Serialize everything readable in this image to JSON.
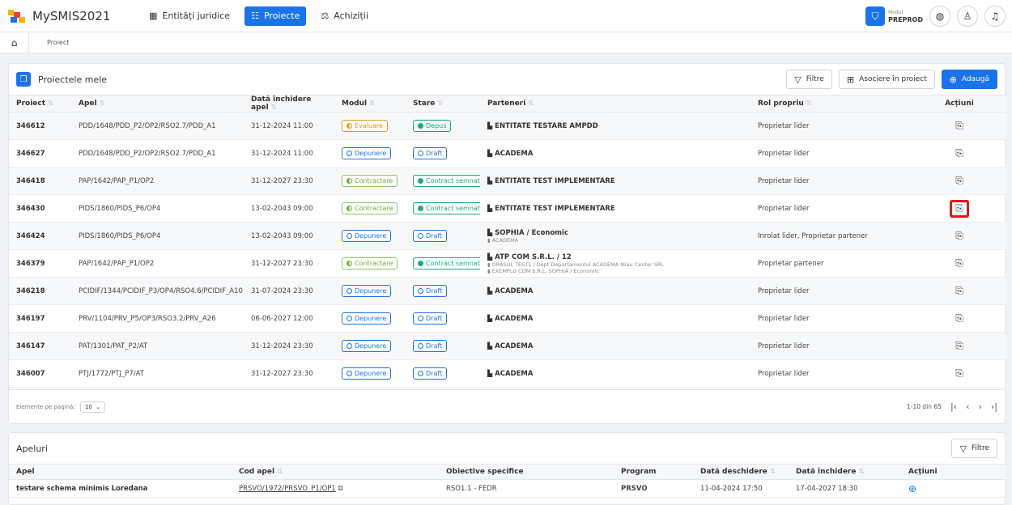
{
  "app": {
    "name": "MySMIS2021"
  },
  "nav": [
    {
      "label": "Entități juridice",
      "icon": "building-icon",
      "active": false
    },
    {
      "label": "Proiecte",
      "icon": "projects-icon",
      "active": true
    },
    {
      "label": "Achiziții",
      "icon": "scale-icon",
      "active": false
    }
  ],
  "mode": {
    "line1": "Modul",
    "line2": "PREPROD"
  },
  "breadcrumb": {
    "current": "Proiect"
  },
  "projects": {
    "title": "Proiectele mele",
    "filter_label": "Filtre",
    "associate_label": "Asociere în proiect",
    "add_label": "Adaugă",
    "columns": [
      "Proiect",
      "Apel",
      "Dată închidere apel",
      "Modul",
      "Stare",
      "Parteneri",
      "Rol propriu",
      "Acțiuni"
    ],
    "rows": [
      {
        "id": "346612",
        "apel": "PDD/1648/PDD_P2/OP2/RSO2.7/PDD_A1",
        "date": "31-12-2024 11:00",
        "modul": "Evaluare",
        "modul_type": "eval",
        "stare": "Depus",
        "stare_type": "depus",
        "partner": "ENTITATE TESTARE AMPDD",
        "sub": "",
        "rol": "Proprietar lider"
      },
      {
        "id": "346627",
        "apel": "PDD/1648/PDD_P2/OP2/RSO2.7/PDD_A1",
        "date": "31-12-2024 11:00",
        "modul": "Depunere",
        "modul_type": "dep",
        "stare": "Draft",
        "stare_type": "draft",
        "partner": "ACADEMA",
        "sub": "",
        "rol": "Proprietar lider"
      },
      {
        "id": "346418",
        "apel": "PAP/1642/PAP_P1/OP2",
        "date": "31-12-2027 23:30",
        "modul": "Contractare",
        "modul_type": "ctr",
        "stare": "Contract semnat",
        "stare_type": "sem",
        "partner": "ENTITATE TEST IMPLEMENTARE",
        "sub": "",
        "rol": "Proprietar lider"
      },
      {
        "id": "346430",
        "apel": "PIDS/1860/PIDS_P6/OP4",
        "date": "13-02-2043 09:00",
        "modul": "Contractare",
        "modul_type": "ctr",
        "stare": "Contract semnat",
        "stare_type": "sem",
        "partner": "ENTITATE TEST IMPLEMENTARE",
        "sub": "",
        "rol": "Proprietar lider"
      },
      {
        "id": "346424",
        "apel": "PIDS/1860/PIDS_P6/OP4",
        "date": "13-02-2043 09:00",
        "modul": "Depunere",
        "modul_type": "dep",
        "stare": "Draft",
        "stare_type": "draft",
        "partner": "SOPHIA / Economic",
        "sub": "ACADEMA",
        "rol": "Inrolat lider, Proprietar partener"
      },
      {
        "id": "346379",
        "apel": "PAP/1642/PAP_P1/OP2",
        "date": "31-12-2027 23:30",
        "modul": "Contractare",
        "modul_type": "ctr",
        "stare": "Contract semnat",
        "stare_type": "sem",
        "partner": "ATP COM S.R.L. / 12",
        "sub": "ORASUL TEST1 / Dept Departamentul   ACADEMA   Miau Center SRL",
        "sub2": "EXEMPLU COM S.R.L.   SOPHIA / Economic",
        "rol": "Proprietar partener"
      },
      {
        "id": "346218",
        "apel": "PCIDIF/1344/PCIDIF_P3/OP4/RSO4.6/PCIDIF_A10",
        "date": "31-07-2024 23:30",
        "modul": "Depunere",
        "modul_type": "dep",
        "stare": "Draft",
        "stare_type": "draft",
        "partner": "ACADEMA",
        "sub": "",
        "rol": "Proprietar lider"
      },
      {
        "id": "346197",
        "apel": "PRV/1104/PRV_P5/OP3/RSO3.2/PRV_A26",
        "date": "06-06-2027 12:00",
        "modul": "Depunere",
        "modul_type": "dep",
        "stare": "Draft",
        "stare_type": "draft",
        "partner": "ACADEMA",
        "sub": "",
        "rol": "Proprietar lider"
      },
      {
        "id": "346147",
        "apel": "PAT/1301/PAT_P2/AT",
        "date": "31-12-2024 23:30",
        "modul": "Depunere",
        "modul_type": "dep",
        "stare": "Draft",
        "stare_type": "draft",
        "partner": "ACADEMA",
        "sub": "",
        "rol": "Proprietar lider"
      },
      {
        "id": "346007",
        "apel": "PTJ/1772/PTJ_P7/AT",
        "date": "31-12-2027 23:30",
        "modul": "Depunere",
        "modul_type": "dep",
        "stare": "Draft",
        "stare_type": "draft",
        "partner": "ACADEMA",
        "sub": "",
        "rol": "Proprietar lider"
      }
    ],
    "highlighted_row": 3,
    "per_page_label": "Elemente pe pagină:",
    "per_page_value": "10",
    "range": "1-10 din 65"
  },
  "apeluri": {
    "title": "Apeluri",
    "filter_label": "Filtre",
    "columns": [
      "Apel",
      "Cod apel",
      "Obiective specifice",
      "Program",
      "Dată deschidere",
      "Dată închidere",
      "Acțiuni"
    ],
    "rows": [
      {
        "apel": "testare schema minimis Loredana",
        "cod": "PRSVO/1972/PRSVO_P1/OP1",
        "obiective": "RSO1.1 - FEDR",
        "program": "PRSVO",
        "open": "11-04-2024 17:50",
        "close": "17-04-2027 18:30"
      }
    ]
  },
  "colors": {
    "accent": "#1a73e8",
    "highlight": "#e01a1a"
  }
}
